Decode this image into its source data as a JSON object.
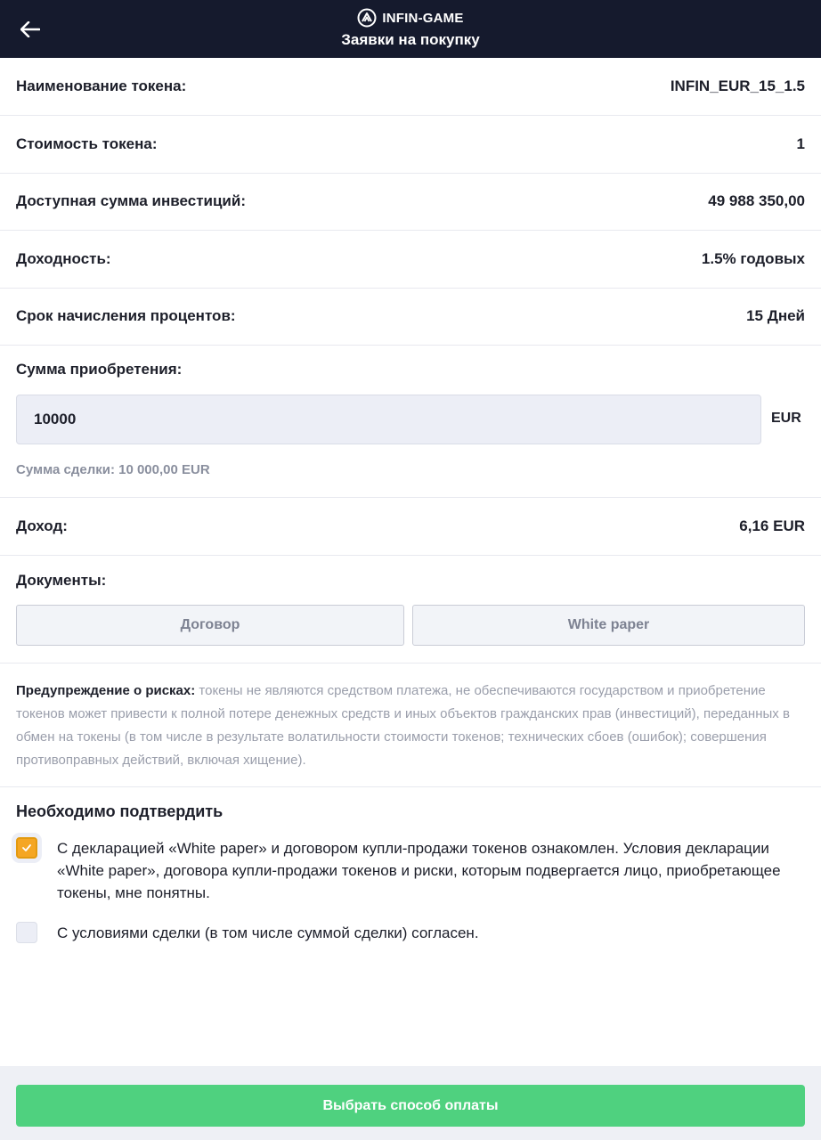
{
  "header": {
    "brand": "INFIN-GAME",
    "title": "Заявки на покупку"
  },
  "details": [
    {
      "label": "Наименование токена:",
      "value": "INFIN_EUR_15_1.5"
    },
    {
      "label": "Стоимость токена:",
      "value": "1"
    },
    {
      "label": "Доступная сумма инвестиций:",
      "value": "49 988 350,00"
    },
    {
      "label": "Доходность:",
      "value": "1.5% годовых"
    },
    {
      "label": "Срок начисления процентов:",
      "value": "15 Дней"
    }
  ],
  "purchase": {
    "label": "Сумма приобретения:",
    "amount_value": "10000",
    "currency": "EUR",
    "deal_sum": "Сумма сделки: 10 000,00 EUR"
  },
  "income": {
    "label": "Доход:",
    "value": "6,16 EUR"
  },
  "documents": {
    "label": "Документы:",
    "contract_label": "Договор",
    "whitepaper_label": "White paper"
  },
  "warning": {
    "title": "Предупреждение о рисках:",
    "text": " токены не являются средством платежа, не обеспечиваются государством и приобретение токенов может привести к полной потере денежных средств и иных объектов гражданских прав (инвестиций), переданных в обмен на токены (в том числе в результате волатильности стоимости токенов; технических сбоев (ошибок); совершения противоправных действий, включая хищение)."
  },
  "confirmation": {
    "title": "Необходимо подтвердить",
    "items": [
      {
        "text": "С декларацией «White paper» и договором купли-продажи токенов ознакомлен. Условия декларации «White paper», договора купли-продажи токенов и риски, которым подвергается лицо, приобретающее токены, мне понятны.",
        "checked": true
      },
      {
        "text": "С условиями сделки (в том числе суммой сделки) согласен.",
        "checked": false
      }
    ]
  },
  "footer": {
    "pay_button": "Выбрать способ оплаты"
  },
  "colors": {
    "header_bg": "#151a2d",
    "accent_green": "#4fd17f",
    "checkbox_orange": "#f5a623"
  }
}
